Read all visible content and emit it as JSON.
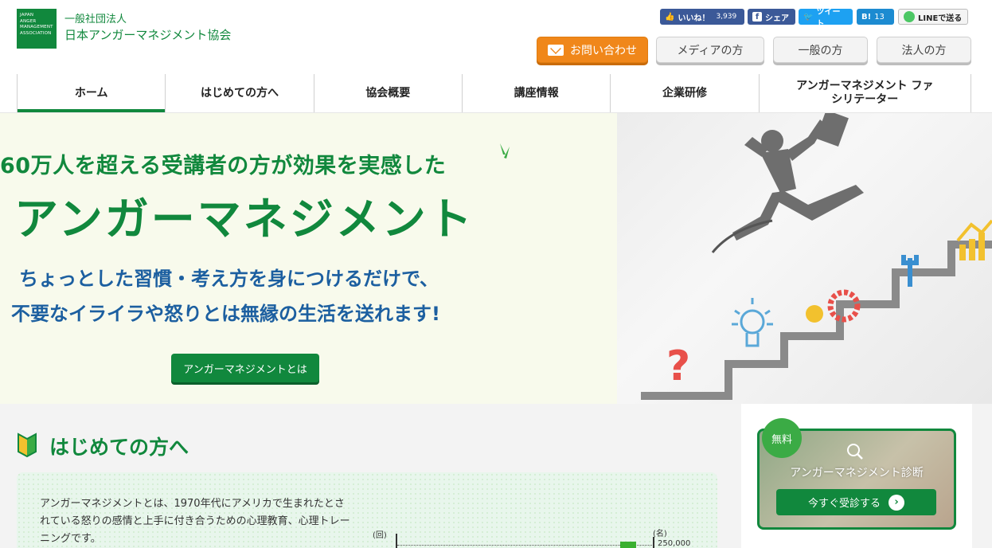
{
  "header": {
    "logo_text": "JAPAN ANGER MANAGEMENT ASSOCIATION",
    "org_type": "一般社団法人",
    "org_name": "日本アンガーマネジメント協会"
  },
  "social": {
    "fb_like_label": "いいね！",
    "fb_like_count": "3,939",
    "fb_share_label": "シェア",
    "tweet_label": "ツイート",
    "hatena_label": "B!",
    "hatena_count": "13",
    "line_label": "LINEで送る"
  },
  "header_buttons": {
    "contact": "お問い合わせ",
    "media": "メディアの方",
    "general": "一般の方",
    "corporate": "法人の方"
  },
  "nav": {
    "items": [
      "ホーム",
      "はじめての方へ",
      "協会概要",
      "講座情報",
      "企業研修",
      "アンガーマネジメント ファシリテーター"
    ],
    "active_index": 0
  },
  "hero": {
    "line1": "60万人を超える受講者の方が効果を実感した",
    "line2": "アンガーマネジメント",
    "line3": "ちょっとした習慣・考え方を身につけるだけで、",
    "line4": "不要なイライラや怒りとは無縁の生活を送れます!",
    "button": "アンガーマネジメントとは"
  },
  "intro": {
    "title": "はじめての方へ",
    "text": "アンガーマネジメントとは、1970年代にアメリカで生まれたとされている怒りの感情と上手に付き合うための心理教育、心理トレーニングです。",
    "graph_left_unit": "(回)",
    "graph_right_unit": "(名)",
    "graph_value": "250,000"
  },
  "diagnosis": {
    "badge": "無料",
    "title": "アンガーマネジメント診断",
    "button": "今すぐ受診する"
  },
  "colors": {
    "brand_green": "#11883d",
    "contact_orange": "#f0871a",
    "hero_blue": "#1c5fa0"
  }
}
